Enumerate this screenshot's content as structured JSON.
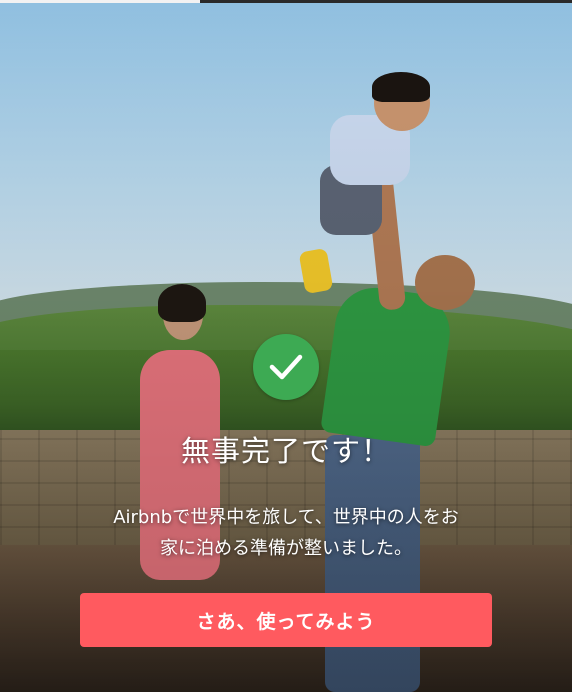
{
  "onboarding": {
    "icon": "checkmark-icon",
    "title": "無事完了です！",
    "message_line1": "Airbnbで世界中を旅して、世界中の人をお",
    "message_line2": "家に泊める準備が整いました。",
    "cta_label": "さあ、使ってみよう"
  },
  "colors": {
    "accent": "#ff5a5f",
    "success": "#3daa53",
    "text": "#ffffff"
  }
}
